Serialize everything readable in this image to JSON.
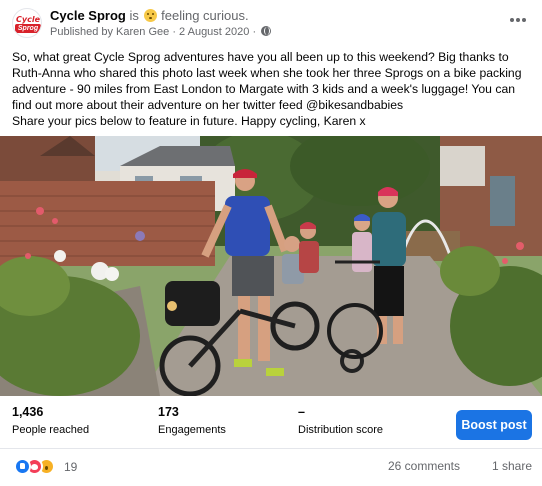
{
  "header": {
    "page_name": "Cycle Sprog",
    "is_text": "is",
    "feeling_text": "feeling curious.",
    "published_by": "Published by Karen Gee",
    "separator": "·",
    "date": "2 August 2020",
    "more_icon": "more-horizontal-icon",
    "globe_icon": "globe-icon",
    "avatar_logo_top": "Cycle",
    "avatar_logo_bottom": "Sprog"
  },
  "post": {
    "paragraph1": "So, what great Cycle Sprog adventures have you all been up to this weekend?  Big thanks to Ruth-Anna who shared this photo last week when she took her three Sprogs on a bike packing adventure - 90 miles from East London to Margate with 3 kids and a week's luggage! You can find out more about their adventure on her twitter feed @bikesandbabies",
    "paragraph2": "Share your pics below to feature in future.  Happy cycling, Karen x"
  },
  "stats": {
    "reached_value": "1,436",
    "reached_label": "People reached",
    "engagements_value": "173",
    "engagements_label": "Engagements",
    "distribution_value": "–",
    "distribution_label": "Distribution score",
    "boost_label": "Boost post"
  },
  "footer": {
    "reaction_count": "19",
    "comments": "26 comments",
    "shares": "1 share"
  },
  "colors": {
    "accent": "#1b74e4",
    "text_secondary": "#65676b",
    "brand_red": "#d8212a"
  }
}
